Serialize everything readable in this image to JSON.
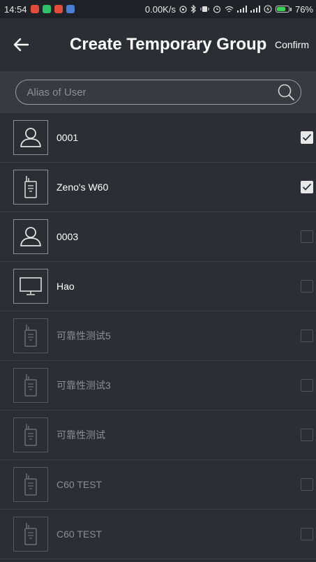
{
  "status_bar": {
    "time": "14:54",
    "network_speed": "0.00K/s",
    "battery_percent": "76%",
    "battery_level": 0.76,
    "app_icons": [
      "red-app-icon",
      "wechat-icon",
      "weibo-icon",
      "notes-icon"
    ],
    "app_icon_colors": [
      "#e34b3a",
      "#2ec16b",
      "#e34b3a",
      "#4a7fd6"
    ]
  },
  "header": {
    "title": "Create Temporary Group",
    "confirm_label": "Confirm",
    "back_icon": "arrow-left-icon"
  },
  "search": {
    "placeholder": "Alias of User",
    "value": ""
  },
  "members": [
    {
      "label": "0001",
      "icon": "user-icon",
      "checked": true,
      "enabled": true
    },
    {
      "label": "Zeno's W60",
      "icon": "radio-icon",
      "checked": true,
      "enabled": true
    },
    {
      "label": "0003",
      "icon": "user-icon",
      "checked": false,
      "enabled": true
    },
    {
      "label": "Hao",
      "icon": "monitor-icon",
      "checked": false,
      "enabled": true
    },
    {
      "label": "可靠性测试5",
      "icon": "radio-icon",
      "checked": false,
      "enabled": false
    },
    {
      "label": "可靠性测试3",
      "icon": "radio-icon",
      "checked": false,
      "enabled": false
    },
    {
      "label": "可靠性测试",
      "icon": "radio-icon",
      "checked": false,
      "enabled": false
    },
    {
      "label": "C60 TEST",
      "icon": "radio-icon",
      "checked": false,
      "enabled": false
    },
    {
      "label": "C60 TEST",
      "icon": "radio-icon",
      "checked": false,
      "enabled": false
    }
  ]
}
